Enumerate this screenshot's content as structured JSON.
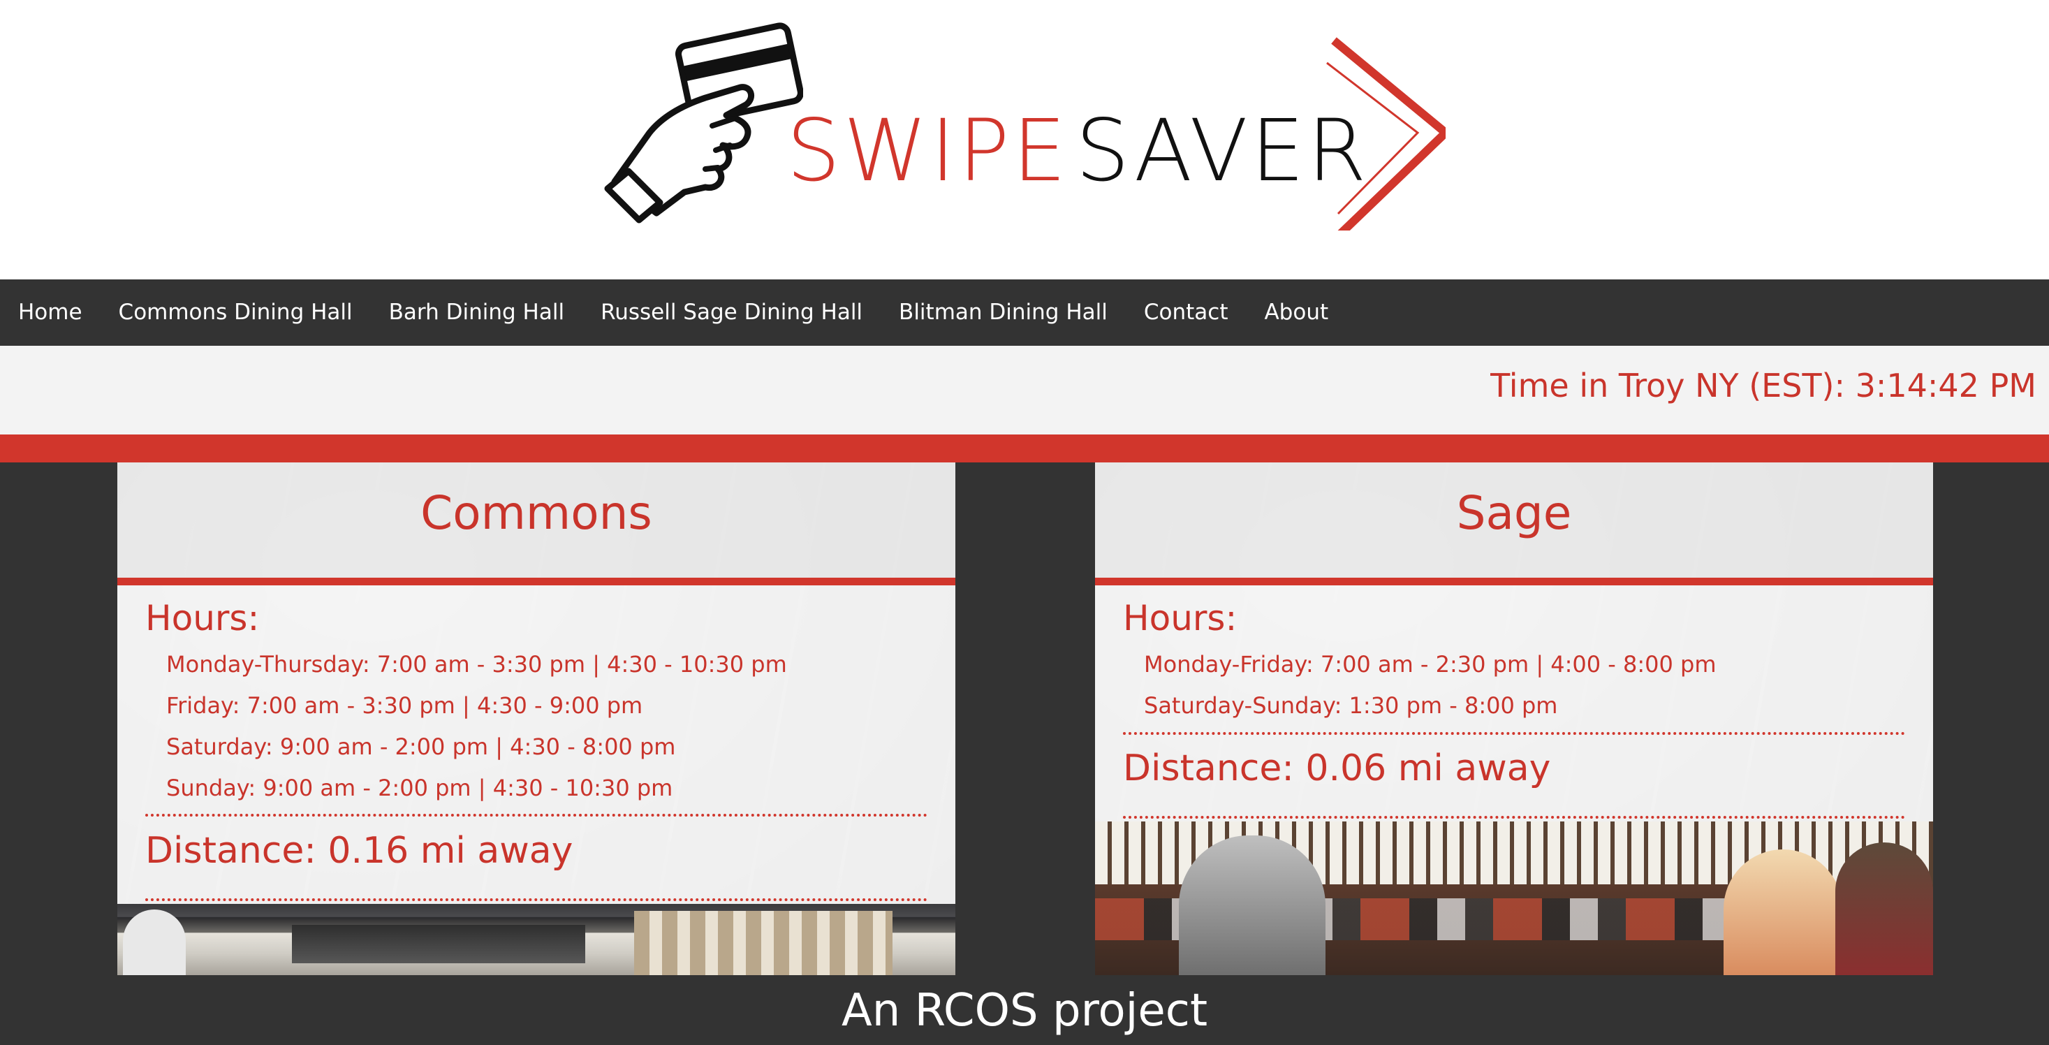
{
  "logo": {
    "word1": "SWIPE",
    "word2": "SAVER",
    "icon": "hand-holding-card-icon",
    "accent_color": "#d1362c"
  },
  "nav": {
    "items": [
      {
        "label": "Home"
      },
      {
        "label": "Commons Dining Hall"
      },
      {
        "label": "Barh Dining Hall"
      },
      {
        "label": "Russell Sage Dining Hall"
      },
      {
        "label": "Blitman Dining Hall"
      },
      {
        "label": "Contact"
      },
      {
        "label": "About"
      }
    ]
  },
  "clock": {
    "text": "Time in Troy NY (EST): 3:14:42 PM"
  },
  "cards": [
    {
      "title": "Commons",
      "hours_label": "Hours:",
      "hours": [
        "Monday-Thursday: 7:00 am - 3:30 pm | 4:30 - 10:30 pm",
        "Friday: 7:00 am - 3:30 pm | 4:30 - 9:00 pm",
        "Saturday: 9:00 am - 2:00 pm | 4:30 - 8:00 pm",
        "Sunday: 9:00 am - 2:00 pm | 4:30 - 10:30 pm"
      ],
      "distance": "Distance: 0.16 mi away"
    },
    {
      "title": "Sage",
      "hours_label": "Hours:",
      "hours": [
        "Monday-Friday: 7:00 am - 2:30 pm | 4:00 - 8:00 pm",
        "Saturday-Sunday: 1:30 pm - 8:00 pm"
      ],
      "distance": "Distance: 0.06 mi away"
    }
  ],
  "footer": {
    "text": "An RCOS project"
  },
  "colors": {
    "accent": "#d1362c",
    "dark": "#333333",
    "light": "#f3f3f3"
  }
}
